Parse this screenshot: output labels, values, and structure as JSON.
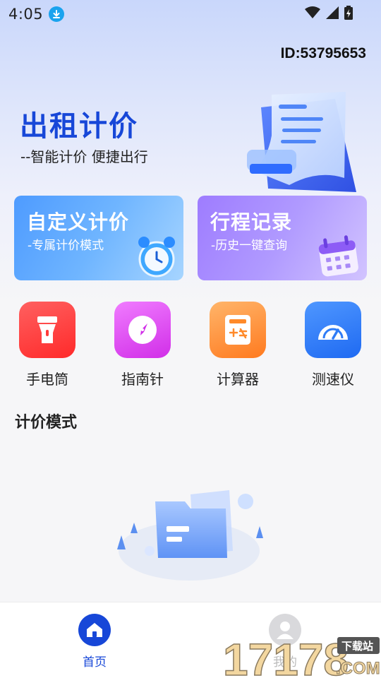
{
  "status_bar": {
    "time": "4:05"
  },
  "header": {
    "user_id": "ID:53795653"
  },
  "hero": {
    "title": "出租计价",
    "subtitle": "--智能计价 便捷出行"
  },
  "cards": [
    {
      "title": "自定义计价",
      "subtitle": "-专属计价模式",
      "icon": "alarm-clock-icon",
      "color": "#4e9bff"
    },
    {
      "title": "行程记录",
      "subtitle": "-历史一键查询",
      "icon": "calendar-icon",
      "color": "#9e7cff"
    }
  ],
  "tools": [
    {
      "label": "手电筒",
      "icon": "flashlight-icon",
      "color": "#ff3b3b"
    },
    {
      "label": "指南针",
      "icon": "compass-icon",
      "color": "#e04cf0"
    },
    {
      "label": "计算器",
      "icon": "calculator-icon",
      "color": "#ff8a2a"
    },
    {
      "label": "测速仪",
      "icon": "speedometer-icon",
      "color": "#2f7cf6"
    }
  ],
  "section": {
    "title": "计价模式"
  },
  "tabbar": {
    "tabs": [
      {
        "label": "首页",
        "icon": "home-icon",
        "active": true,
        "color": "#1747d8"
      },
      {
        "label": "我的",
        "icon": "user-icon",
        "active": false,
        "color": "#bbbbbb"
      }
    ]
  },
  "watermark": {
    "text": "17178",
    "badge": "下载站",
    "suffix": ".COM"
  }
}
